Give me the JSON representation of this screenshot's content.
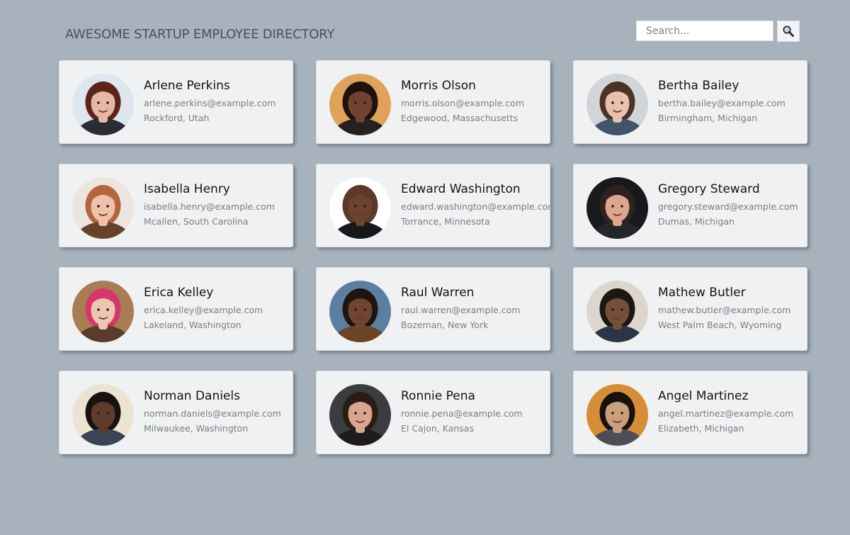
{
  "header": {
    "title": "AWESOME STARTUP EMPLOYEE DIRECTORY",
    "search_placeholder": "Search...",
    "search_value": "",
    "search_button_icon": "magnifier-icon"
  },
  "employees": [
    {
      "name": "Arlene Perkins",
      "email": "arlene.perkins@example.com",
      "location": "Rockford, Utah",
      "avatar": {
        "bg": "#dfe6ef",
        "skin": "#e5b7a6",
        "hair": "#5a2418",
        "clothes": "#2b2b34"
      }
    },
    {
      "name": "Morris Olson",
      "email": "morris.olson@example.com",
      "location": "Edgewood, Massachusetts",
      "avatar": {
        "bg": "#e0a25b",
        "skin": "#6e4330",
        "hair": "#1d120d",
        "clothes": "#24211f"
      }
    },
    {
      "name": "Bertha Bailey",
      "email": "bertha.bailey@example.com",
      "location": "Birmingham, Michigan",
      "avatar": {
        "bg": "#d2d5d8",
        "skin": "#e7c0ae",
        "hair": "#4c3326",
        "clothes": "#41546a"
      }
    },
    {
      "name": "Isabella Henry",
      "email": "isabella.henry@example.com",
      "location": "Mcallen, South Carolina",
      "avatar": {
        "bg": "#ece5df",
        "skin": "#edc1aa",
        "hair": "#b4653d",
        "clothes": "#66412c"
      }
    },
    {
      "name": "Edward Washington",
      "email": "edward.washington@example.com",
      "location": "Torrance, Minnesota",
      "avatar": {
        "bg": "#ffffff",
        "skin": "#6b4330",
        "hair": "#5c3929",
        "clothes": "#17181b"
      }
    },
    {
      "name": "Gregory Steward",
      "email": "gregory.steward@example.com",
      "location": "Dumas, Michigan",
      "avatar": {
        "bg": "#17191c",
        "skin": "#dca58e",
        "hair": "#2e221c",
        "clothes": "#25262a"
      }
    },
    {
      "name": "Erica Kelley",
      "email": "erica.kelley@example.com",
      "location": "Lakeland, Washington",
      "avatar": {
        "bg": "#a97d54",
        "skin": "#eec4b2",
        "hair": "#d6366b",
        "clothes": "#5a3b2c"
      }
    },
    {
      "name": "Raul Warren",
      "email": "raul.warren@example.com",
      "location": "Bozeman, New York",
      "avatar": {
        "bg": "#5c7fa1",
        "skin": "#70452f",
        "hair": "#1f140f",
        "clothes": "#6a4424"
      }
    },
    {
      "name": "Mathew Butler",
      "email": "mathew.butler@example.com",
      "location": "West Palm Beach, Wyoming",
      "avatar": {
        "bg": "#ddd6cf",
        "skin": "#74503b",
        "hair": "#1e1612",
        "clothes": "#2b3547"
      }
    },
    {
      "name": "Norman Daniels",
      "email": "norman.daniels@example.com",
      "location": "Milwaukee, Washington",
      "avatar": {
        "bg": "#ece3d2",
        "skin": "#5e3b2c",
        "hair": "#1a120e",
        "clothes": "#3b4455"
      }
    },
    {
      "name": "Ronnie Pena",
      "email": "ronnie.pena@example.com",
      "location": "El Cajon, Kansas",
      "avatar": {
        "bg": "#3a3c40",
        "skin": "#d9a58e",
        "hair": "#2a1c14",
        "clothes": "#1c1c1f"
      }
    },
    {
      "name": "Angel Martinez",
      "email": "angel.martinez@example.com",
      "location": "Elizabeth, Michigan",
      "avatar": {
        "bg": "#d78d35",
        "skin": "#caa07c",
        "hair": "#161210",
        "clothes": "#4d4e55"
      }
    }
  ]
}
